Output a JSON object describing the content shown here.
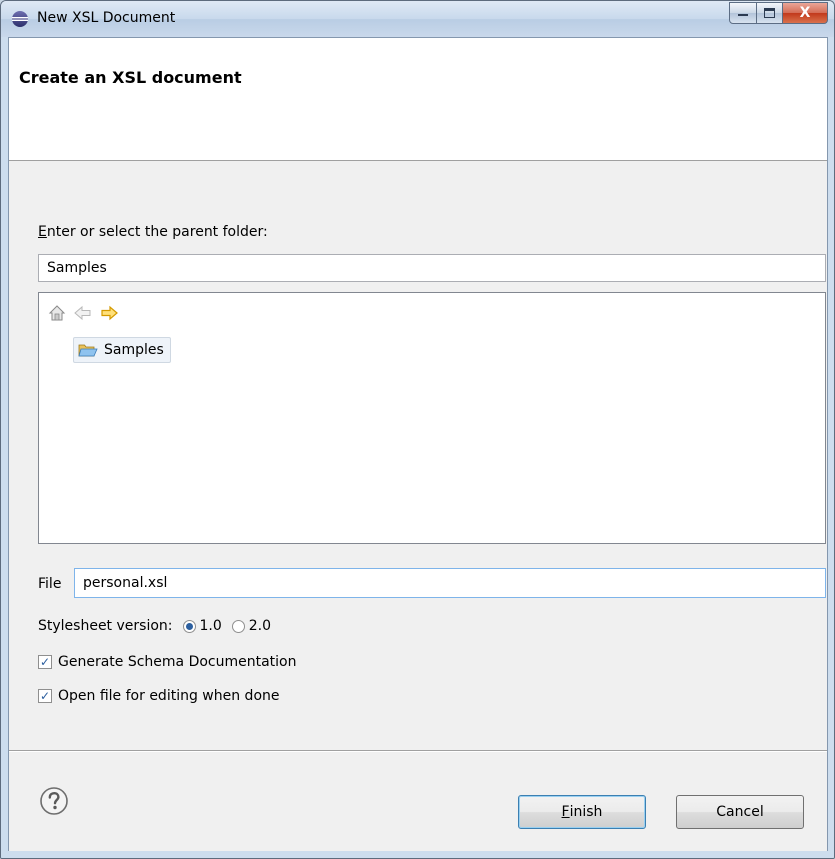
{
  "window": {
    "title": "New XSL Document",
    "controls": {
      "minimize": "minimize",
      "maximize": "maximize",
      "close": "X"
    }
  },
  "header": {
    "title": "Create an XSL document"
  },
  "folder": {
    "label_mnemonic": "E",
    "label_rest": "nter or select the parent folder:",
    "value": "Samples"
  },
  "tree": {
    "nav_icons": [
      "home-icon",
      "back-arrow-icon",
      "forward-arrow-icon"
    ],
    "items": [
      {
        "label": "Samples",
        "icon": "folder-open-icon",
        "selected": true
      }
    ]
  },
  "file": {
    "label": "File",
    "value": "personal.xsl"
  },
  "stylesheet": {
    "label": "Stylesheet version:",
    "options": [
      {
        "label": "1.0",
        "selected": true
      },
      {
        "label": "2.0",
        "selected": false
      }
    ]
  },
  "options": {
    "generate_schema_doc": {
      "label": "Generate Schema Documentation",
      "checked": true
    },
    "open_for_editing": {
      "label": "Open file for editing when done",
      "checked": true
    }
  },
  "footer": {
    "help_icon": "help-icon",
    "finish": {
      "mnemonic": "F",
      "rest": "inish"
    },
    "cancel": "Cancel"
  },
  "colors": {
    "accent": "#2c5f9f",
    "forward_arrow": "#f2b600",
    "titlebar": "#c8d9ec"
  }
}
